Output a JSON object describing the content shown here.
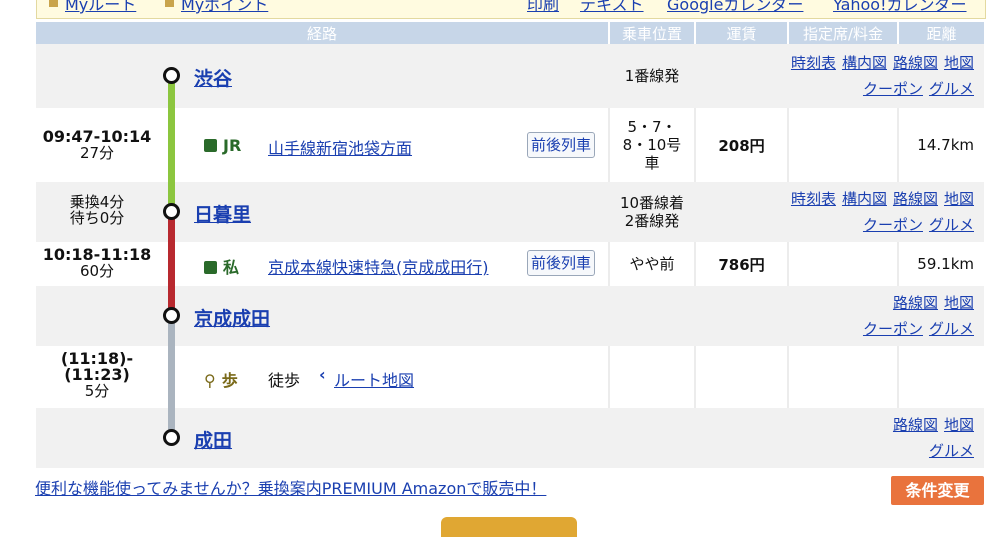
{
  "header_links": {
    "myroute": "Myルート",
    "mypoint": "Myポイント",
    "print": "印刷",
    "text": "テキスト",
    "google_cal": "Googleカレンダー",
    "yahoo_cal": "Yahoo!カレンダー"
  },
  "columns": [
    "経路",
    "乗車位置",
    "運賃",
    "指定席/料金",
    "距離"
  ],
  "stations": [
    {
      "name": "渋谷",
      "position": "1番線発",
      "links_row1": [
        "時刻表",
        "構内図",
        "路線図",
        "地図"
      ],
      "links_row2": [
        "クーポン",
        "グルメ"
      ]
    },
    {
      "name": "日暮里",
      "position": "10番線着\n2番線発",
      "links_row1": [
        "時刻表",
        "構内図",
        "路線図",
        "地図"
      ],
      "links_row2": [
        "クーポン",
        "グルメ"
      ]
    },
    {
      "name": "京成成田",
      "position": "",
      "links_row1": [
        "路線図",
        "地図"
      ],
      "links_row2": [
        "クーポン",
        "グルメ"
      ]
    },
    {
      "name": "成田",
      "position": "",
      "links_row1": [
        "路線図",
        "地図"
      ],
      "links_row2": [
        "グルメ"
      ]
    }
  ],
  "segments": [
    {
      "time": "09:47-10:14",
      "duration": "27分",
      "type_label": "JR",
      "line": "山手線新宿池袋方面",
      "prev_next": "前後列車",
      "car": "5・7・\n8・10号\n車",
      "fare": "208円",
      "seat": "",
      "distance": "14.7km",
      "line_color": "#8cc63f"
    },
    {
      "time": "10:18-11:18",
      "duration": "60分",
      "transfer": "乗換4分\n待ち0分",
      "type_label": "私",
      "line": "京成本線快速特急(京成成田行)",
      "prev_next": "前後列車",
      "car": "やや前",
      "fare": "786円",
      "seat": "",
      "distance": "59.1km",
      "line_color": "#b8292f"
    },
    {
      "time": "(11:18)-\n(11:23)",
      "duration": "5分",
      "type_label": "歩",
      "line": "徒歩",
      "map_link": "ルート地図",
      "car": "",
      "fare": "",
      "seat": "",
      "distance": "",
      "line_color": "#aab4bf"
    }
  ],
  "promo_text": "便利な機能使ってみませんか？乗換案内PREMIUM Amazonで販売中！",
  "change_button": "条件変更"
}
